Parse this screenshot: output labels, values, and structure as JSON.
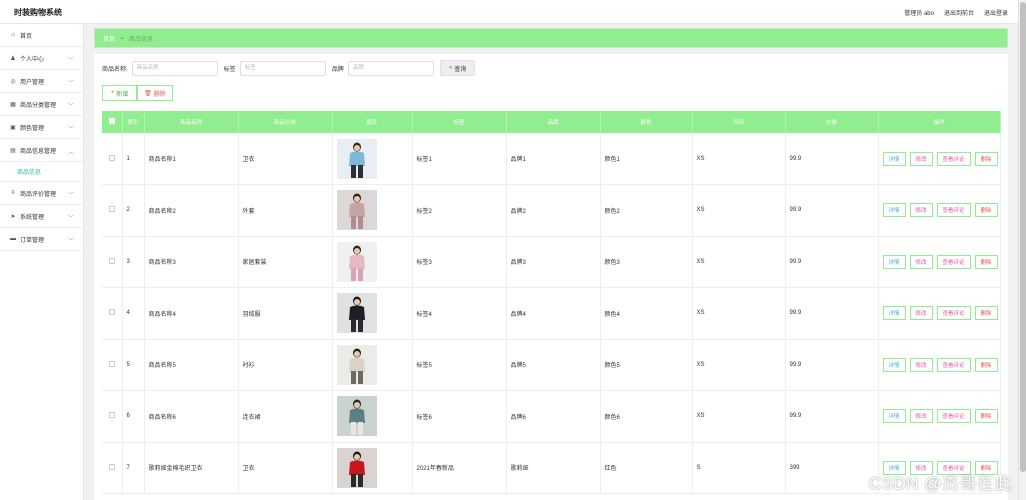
{
  "app": {
    "title": "时装购物系统"
  },
  "header": {
    "admin_label": "管理员 abo",
    "goto_front": "退出到前台",
    "logout": "退出登录"
  },
  "sidebar": {
    "items": [
      {
        "label": "首页",
        "icon": "home-icon",
        "glyph": "⌂",
        "has_chevron": false
      },
      {
        "label": "个人中心",
        "icon": "user-icon",
        "glyph": "♟",
        "has_chevron": true
      },
      {
        "label": "用户管理",
        "icon": "users-icon",
        "glyph": "◎",
        "has_chevron": true
      },
      {
        "label": "商品分类管理",
        "icon": "grid-icon",
        "glyph": "▦",
        "has_chevron": true
      },
      {
        "label": "颜色管理",
        "icon": "palette-icon",
        "glyph": "▣",
        "has_chevron": true
      },
      {
        "label": "商品信息管理",
        "icon": "goods-icon",
        "glyph": "▤",
        "has_chevron": true,
        "expanded": true
      }
    ],
    "active_sub": "商品信息",
    "items_after": [
      {
        "label": "商品评价管理",
        "icon": "list-icon",
        "glyph": "≡",
        "has_chevron": true
      },
      {
        "label": "系统管理",
        "icon": "send-icon",
        "glyph": "➤",
        "has_chevron": true
      },
      {
        "label": "订单管理",
        "icon": "order-icon",
        "glyph": "▬",
        "has_chevron": true
      }
    ]
  },
  "breadcrumb": {
    "home": "首页",
    "separator": "→",
    "current": "商品信息"
  },
  "search": {
    "name_label": "商品名称:",
    "name_placeholder": "商品名称",
    "tag_label": "标签",
    "tag_placeholder": "标签",
    "brand_label": "品牌",
    "brand_placeholder": "品牌",
    "query_button": "查询"
  },
  "actions": {
    "add": "新增",
    "delete": "删除"
  },
  "table": {
    "columns": [
      "索引",
      "商品名称",
      "商品分类",
      "图片",
      "标签",
      "品牌",
      "颜色",
      "尺码",
      "价格",
      "操作"
    ],
    "row_buttons": {
      "detail": "详情",
      "edit": "修改",
      "review": "查看评论",
      "remove": "删除"
    },
    "rows": [
      {
        "index": "1",
        "name": "商品名称1",
        "category": "卫衣",
        "tag": "标签1",
        "brand": "品牌1",
        "color": "颜色1",
        "size": "XS",
        "price": "99.9",
        "img": {
          "bg": "#e9eef2",
          "top": "#7fb7d6",
          "bottom": "#2c2f3a",
          "hair": "#3a2a22"
        }
      },
      {
        "index": "2",
        "name": "商品名称2",
        "category": "外套",
        "tag": "标签2",
        "brand": "品牌2",
        "color": "颜色2",
        "size": "XS",
        "price": "99.9",
        "img": {
          "bg": "#dcd8d6",
          "top": "#c7a3a7",
          "bottom": "#b28c90",
          "hair": "#2b2220"
        }
      },
      {
        "index": "3",
        "name": "商品名称3",
        "category": "家居套装",
        "tag": "标签3",
        "brand": "品牌3",
        "color": "颜色3",
        "size": "XS",
        "price": "99.9",
        "img": {
          "bg": "#eef0f2",
          "top": "#e6b8c2",
          "bottom": "#d8a2b0",
          "hair": "#2d2220"
        }
      },
      {
        "index": "4",
        "name": "商品名称4",
        "category": "羽绒服",
        "tag": "标签4",
        "brand": "品牌4",
        "color": "颜色4",
        "size": "XS",
        "price": "99.9",
        "img": {
          "bg": "#dfe1e3",
          "top": "#1e1f24",
          "bottom": "#2a2b30",
          "hair": "#1a1a1a"
        }
      },
      {
        "index": "5",
        "name": "商品名称5",
        "category": "衬衫",
        "tag": "标签5",
        "brand": "品牌5",
        "color": "颜色5",
        "size": "XS",
        "price": "99.9",
        "img": {
          "bg": "#ecebe8",
          "top": "#d9d2c5",
          "bottom": "#6e6a5e",
          "hair": "#2a201a"
        }
      },
      {
        "index": "6",
        "name": "商品名称6",
        "category": "连衣裙",
        "tag": "标签6",
        "brand": "品牌6",
        "color": "颜色6",
        "size": "XS",
        "price": "99.9",
        "img": {
          "bg": "#c9d4cc",
          "top": "#5c7f86",
          "bottom": "#e8e6e2",
          "hair": "#2c2622"
        }
      },
      {
        "index": "7",
        "name": "歌莉娅金棉毛织卫衣",
        "category": "卫衣",
        "tag": "2021年春新品",
        "brand": "歌莉娅",
        "color": "红色",
        "size": "S",
        "price": "399",
        "img": {
          "bg": "#d9d4d0",
          "top": "#c8161d",
          "bottom": "#2a2a2a",
          "hair": "#1e1410"
        }
      }
    ]
  },
  "watermark": "CSDN @杰哥在此"
}
